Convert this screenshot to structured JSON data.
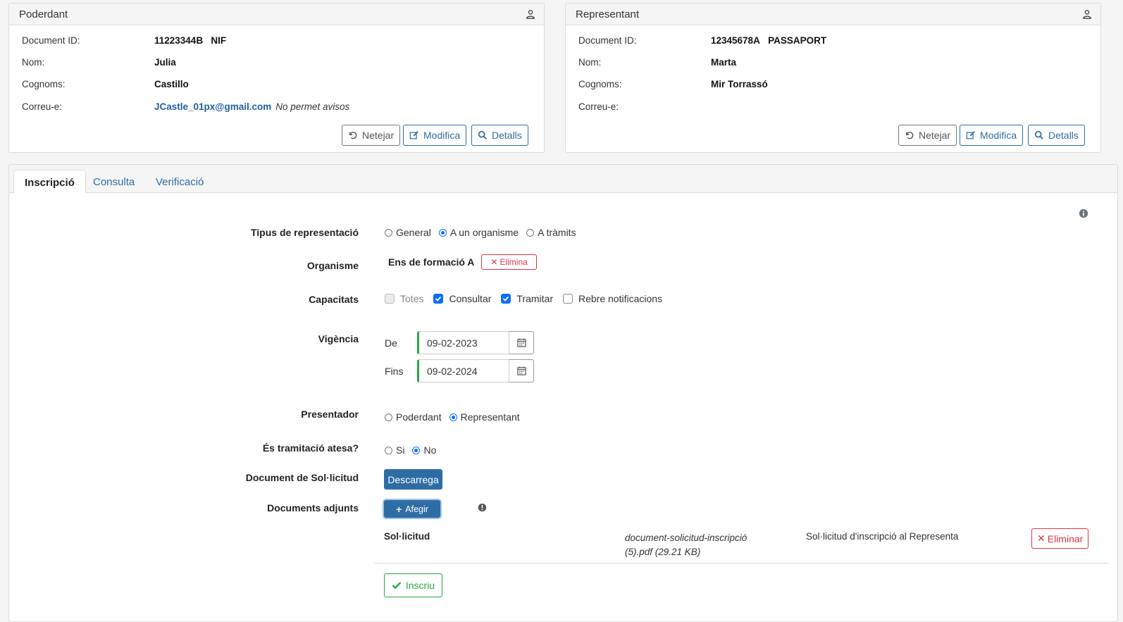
{
  "poderdant": {
    "title": "Poderdant",
    "doc_id_label": "Document ID:",
    "doc_id_value": "11223344B",
    "doc_type": "NIF",
    "nom_label": "Nom:",
    "nom_value": "Julia",
    "cognoms_label": "Cognoms:",
    "cognoms_value": "Castillo",
    "email_label": "Correu-e:",
    "email_value": "JCastle_01px@gmail.com",
    "email_note": "No permet avisos"
  },
  "representant": {
    "title": "Representant",
    "doc_id_label": "Document ID:",
    "doc_id_value": "12345678A",
    "doc_type": "PASSAPORT",
    "nom_label": "Nom:",
    "nom_value": "Marta",
    "cognoms_label": "Cognoms:",
    "cognoms_value": "Mir Torrassó",
    "email_label": "Correu-e:",
    "email_value": ""
  },
  "panel_buttons": {
    "clear": "Netejar",
    "modify": "Modifica",
    "details": "Detalls"
  },
  "tabs": [
    {
      "label": "Inscripció",
      "active": true
    },
    {
      "label": "Consulta",
      "active": false
    },
    {
      "label": "Verificació",
      "active": false
    }
  ],
  "form": {
    "tipus_label": "Tipus de representació",
    "tipus_options": [
      "General",
      "A un organisme",
      "A tràmits"
    ],
    "tipus_selected": "A un organisme",
    "organisme_label": "Organisme",
    "organisme_value": "Ens de formació A",
    "organisme_remove": "Elimina",
    "capacitats_label": "Capacitats",
    "capacitats": [
      {
        "label": "Totes",
        "checked": false,
        "disabled": true
      },
      {
        "label": "Consultar",
        "checked": true,
        "disabled": false
      },
      {
        "label": "Tramitar",
        "checked": true,
        "disabled": false
      },
      {
        "label": "Rebre notificacions",
        "checked": false,
        "disabled": false
      }
    ],
    "vigencia_label": "Vigència",
    "de_label": "De",
    "de_value": "09-02-2023",
    "fins_label": "Fins",
    "fins_value": "09-02-2024",
    "presentador_label": "Presentador",
    "presentador_options": [
      "Poderdant",
      "Representant"
    ],
    "presentador_selected": "Representant",
    "atesa_label": "És tramitació atesa?",
    "atesa_options": [
      "Si",
      "No"
    ],
    "atesa_selected": "No",
    "doc_sol_label": "Document de Sol·licitud",
    "download_button": "Descarrega",
    "adjunts_label": "Documents adjunts",
    "add_button": "Afegir",
    "attachment": {
      "type": "Sol·licitud",
      "file_line1": "document-solicitud-inscripció",
      "file_line2": "(5).pdf (29.21 KB)",
      "description": "Sol·licitud d'inscripció al Representa",
      "remove": "Eliminar"
    },
    "submit_button": "Inscriu"
  }
}
